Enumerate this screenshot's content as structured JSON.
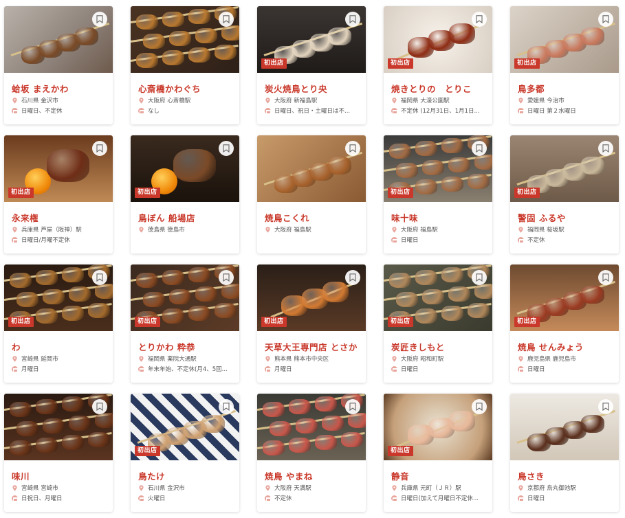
{
  "badge_label": "初出店",
  "colors": {
    "accent": "#c9382a",
    "text": "#555555",
    "pin": "#e8a59c"
  },
  "icons": {
    "bookmark": "bookmark-icon",
    "location": "location-pin-icon",
    "holiday": "calendar-icon"
  },
  "cards": [
    {
      "name": "蛤坂 まえかわ",
      "location": "石川県 金沢市",
      "holiday": "日曜日、不定休",
      "badge": false,
      "photo": "photo-a"
    },
    {
      "name": "心斎橋かわぐち",
      "location": "大阪府 心斎橋駅",
      "holiday": "なし",
      "badge": false,
      "photo": "photo-b"
    },
    {
      "name": "炭火焼鳥とり央",
      "location": "大阪府 新福島駅",
      "holiday": "日曜日、祝日・土曜日は不...",
      "badge": true,
      "photo": "photo-c"
    },
    {
      "name": "焼きとりの　とりこ",
      "location": "福岡県 大濠公園駅",
      "holiday": "不定休 (12月31日、1月1日...",
      "badge": true,
      "photo": "photo-d"
    },
    {
      "name": "鳥多都",
      "location": "愛媛県 今治市",
      "holiday": "日曜日 第２水曜日",
      "badge": true,
      "photo": "photo-e"
    },
    {
      "name": "永来権",
      "location": "兵庫県 芦屋（阪神）駅",
      "holiday": "日曜日/月曜不定休",
      "badge": true,
      "photo": "photo-f"
    },
    {
      "name": "鳥ぼん 船場店",
      "location": "徳島県 徳島市",
      "holiday": "",
      "badge": true,
      "photo": "photo-g"
    },
    {
      "name": "焼鳥こくれ",
      "location": "大阪府 福島駅",
      "holiday": "",
      "badge": false,
      "photo": "photo-h"
    },
    {
      "name": "味十味",
      "location": "大阪府 福島駅",
      "holiday": "日曜日",
      "badge": true,
      "photo": "photo-i"
    },
    {
      "name": "警固 ふるや",
      "location": "福岡県 桜坂駅",
      "holiday": "不定休",
      "badge": true,
      "photo": "photo-j"
    },
    {
      "name": "わ",
      "location": "宮崎県 延岡市",
      "holiday": "月曜日",
      "badge": true,
      "photo": "photo-k"
    },
    {
      "name": "とりかわ 粋恭",
      "location": "福岡県 薬院大通駅",
      "holiday": "年末年始、不定休(月4、5回...",
      "badge": true,
      "photo": "photo-l"
    },
    {
      "name": "天草大王専門店 とさか",
      "location": "熊本県 熊本市中央区",
      "holiday": "月曜日",
      "badge": true,
      "photo": "photo-m"
    },
    {
      "name": "炭匠きしもと",
      "location": "大阪府 昭和町駅",
      "holiday": "日曜日",
      "badge": true,
      "photo": "photo-n"
    },
    {
      "name": "焼鳥 せんみょう",
      "location": "鹿児島県 鹿児島市",
      "holiday": "日曜日",
      "badge": true,
      "photo": "photo-o"
    },
    {
      "name": "味川",
      "location": "宮崎県 宮崎市",
      "holiday": "日祝日、月曜日",
      "badge": false,
      "photo": "photo-p"
    },
    {
      "name": "鳥たけ",
      "location": "石川県 金沢市",
      "holiday": "火曜日",
      "badge": true,
      "photo": "photo-q"
    },
    {
      "name": "焼鳥 やまね",
      "location": "大阪府 天満駅",
      "holiday": "不定休",
      "badge": false,
      "photo": "photo-r"
    },
    {
      "name": "静音",
      "location": "兵庫県 元町（ＪＲ）駅",
      "holiday": "日曜日(加えて月曜日不定休...",
      "badge": true,
      "photo": "photo-s"
    },
    {
      "name": "鳥さき",
      "location": "京都府 烏丸御池駅",
      "holiday": "日曜日",
      "badge": false,
      "photo": "photo-t"
    }
  ]
}
